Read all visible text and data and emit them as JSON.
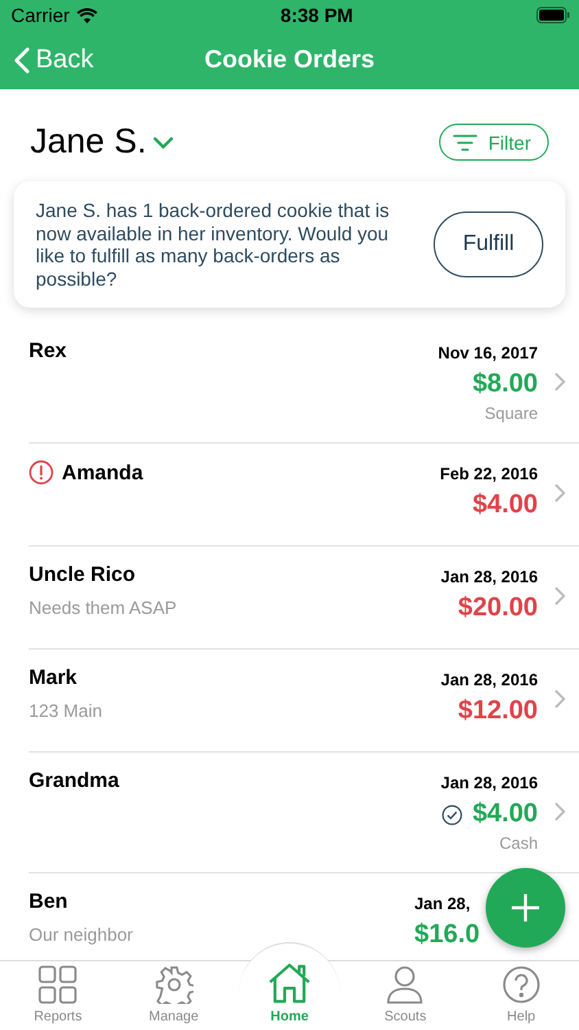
{
  "status_bar": {
    "carrier": "Carrier",
    "time": "8:38 PM"
  },
  "nav": {
    "back": "Back",
    "title": "Cookie Orders"
  },
  "scout": {
    "name": "Jane S.",
    "filter": "Filter"
  },
  "banner": {
    "message": "Jane S. has 1 back-ordered cookie that is now available in her inventory. Would you like to fulfill as many back-orders as possible?",
    "button": "Fulfill"
  },
  "orders": [
    {
      "name": "Rex",
      "date": "Nov 16, 2017",
      "amount": "$8.00",
      "paid": true,
      "payment": "Square"
    },
    {
      "name": "Amanda",
      "alert": true,
      "date": "Feb 22, 2016",
      "amount": "$4.00",
      "paid": false
    },
    {
      "name": "Uncle Rico",
      "note": "Needs them ASAP",
      "date": "Jan 28, 2016",
      "amount": "$20.00",
      "paid": false
    },
    {
      "name": "Mark",
      "note": "123 Main",
      "date": "Jan 28, 2016",
      "amount": "$12.00",
      "paid": false
    },
    {
      "name": "Grandma",
      "delivered": true,
      "date": "Jan 28, 2016",
      "amount": "$4.00",
      "paid": true,
      "payment": "Cash"
    },
    {
      "name": "Ben",
      "note": "Our neighbor",
      "date": "Jan 28,",
      "amount": "$16.0",
      "paid": true,
      "partly_hidden": true
    }
  ],
  "tabs": [
    {
      "label": "Reports",
      "kind": "grid",
      "selected": false
    },
    {
      "label": "Manage",
      "kind": "gear",
      "selected": false
    },
    {
      "label": "Home",
      "kind": "home",
      "selected": true
    },
    {
      "label": "Scouts",
      "kind": "person",
      "selected": false
    },
    {
      "label": "Help",
      "kind": "help",
      "selected": false
    }
  ]
}
